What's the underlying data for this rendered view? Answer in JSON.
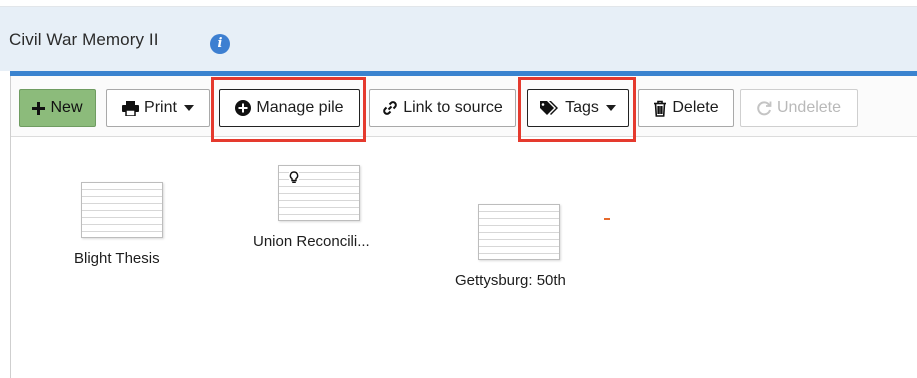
{
  "page": {
    "title": "Civil War Memory II"
  },
  "toolbar": {
    "new_label": "New",
    "print_label": "Print",
    "manage_pile_label": "Manage pile",
    "link_to_source_label": "Link to source",
    "tags_label": "Tags",
    "delete_label": "Delete",
    "undelete_label": "Undelete"
  },
  "items": [
    {
      "caption": "Blight Thesis"
    },
    {
      "caption": "Union Reconcili..."
    },
    {
      "caption": "Gettysburg: 50th"
    }
  ],
  "colors": {
    "accent_bar": "#3a83cf",
    "new_button": "#8cbb7b",
    "highlight": "#e53a2e",
    "title_bg": "#e7eff7"
  },
  "icons": [
    "info-icon",
    "plus-icon",
    "printer-icon",
    "plus-circle-icon",
    "link-icon",
    "tags-icon",
    "trash-icon",
    "undo-icon",
    "lightbulb-icon"
  ]
}
